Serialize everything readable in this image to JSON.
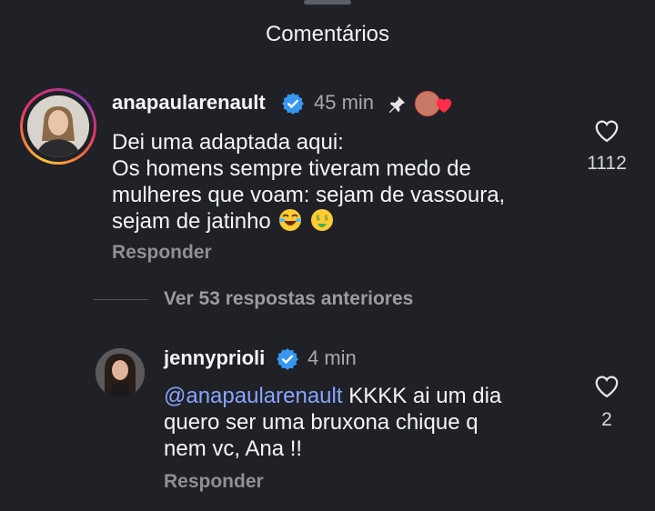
{
  "header": {
    "title": "Comentários"
  },
  "comments": [
    {
      "username": "anapaularenault",
      "time": "45 min",
      "lines": [
        "Dei uma adaptada aqui:",
        "Os homens sempre tiveram medo de",
        "mulheres que voam: sejam de vassoura,",
        "sejam de jatinho"
      ],
      "reply_label": "Responder",
      "likes": "1112",
      "icons": [
        "verified-icon",
        "pin-icon",
        "liked-by-creator-icon",
        "laughing-emoji",
        "money-mouth-emoji",
        "heart-outline-icon"
      ]
    },
    {
      "username": "jennyprioli",
      "time": "4 min",
      "mention": "@anapaularenault",
      "lines": [
        "KKKK ai um dia",
        "quero ser uma bruxona chique q",
        "nem vc, Ana !!"
      ],
      "reply_label": "Responder",
      "likes": "2",
      "icons": [
        "verified-icon",
        "heart-outline-icon"
      ]
    }
  ],
  "thread": {
    "view_more_label": "Ver 53 respostas anteriores"
  },
  "colors": {
    "background": "#1f2126",
    "verified": "#3897f0",
    "mention": "#8aa4ff",
    "muted": "#8e9096"
  }
}
